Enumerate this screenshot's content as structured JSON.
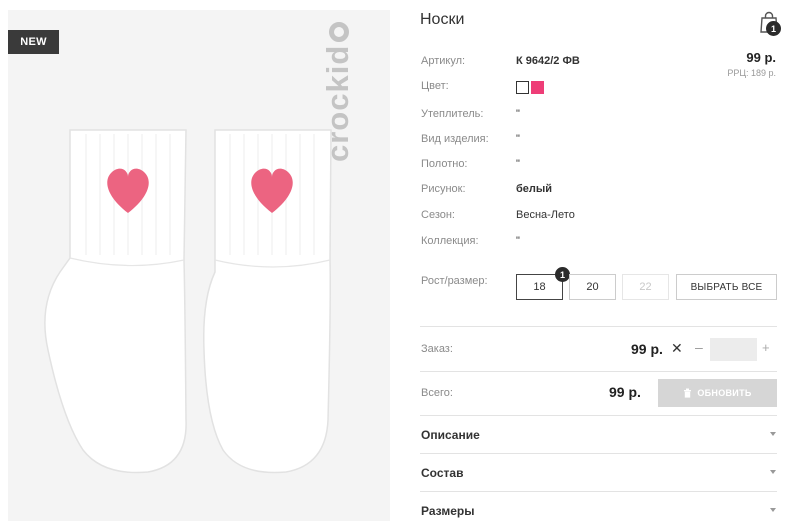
{
  "badge": "NEW",
  "brand": "crockid",
  "product": {
    "title": "Носки",
    "price": "99 р.",
    "rrp": "РРЦ: 189 р."
  },
  "cart": {
    "count": "1"
  },
  "attributes": [
    {
      "label": "Артикул:",
      "value": "К 9642/2 ФВ"
    },
    {
      "label": "Цвет:",
      "value": ""
    },
    {
      "label": "Утеплитель:",
      "value": "\""
    },
    {
      "label": "Вид изделия:",
      "value": "\""
    },
    {
      "label": "Полотно:",
      "value": "\""
    },
    {
      "label": "Рисунок:",
      "value": "белый"
    },
    {
      "label": "Сезон:",
      "value": "Весна-Лето"
    },
    {
      "label": "Коллекция:",
      "value": "\""
    }
  ],
  "colors": [
    "#ffffff",
    "#ee3d77"
  ],
  "size": {
    "label": "Рост/размер:",
    "options": [
      {
        "value": "18",
        "state": "selected",
        "count": "1"
      },
      {
        "value": "20",
        "state": "available"
      },
      {
        "value": "22",
        "state": "disabled"
      }
    ],
    "select_all": "ВЫБРАТЬ ВСЕ"
  },
  "order": {
    "label": "Заказ:",
    "price": "99 р.",
    "remove_icon": "close-icon",
    "minus": "–",
    "plus": "+",
    "quantity": ""
  },
  "total": {
    "label": "Всего:",
    "price": "99 р.",
    "update": "ОБНОВИТЬ"
  },
  "accordion": [
    "Описание",
    "Состав",
    "Размеры"
  ],
  "theme": {
    "heart_color": "#ec6481",
    "badge_bg": "#3a3a3a",
    "button_disabled": "#d6d6d6"
  }
}
